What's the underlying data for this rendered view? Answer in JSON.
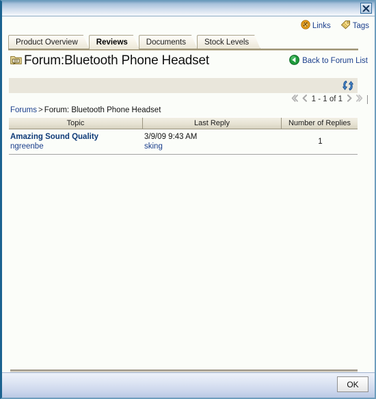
{
  "window": {
    "close_icon": "close-icon"
  },
  "toolbar": {
    "links_label": "Links",
    "links_icon": "links-chain-icon",
    "tags_label": "Tags",
    "tags_icon": "tag-icon"
  },
  "tabs": [
    {
      "label": "Product Overview",
      "active": false
    },
    {
      "label": "Reviews",
      "active": true
    },
    {
      "label": "Documents",
      "active": false
    },
    {
      "label": "Stock Levels",
      "active": false
    }
  ],
  "page": {
    "title": "Forum:Bluetooth Phone Headset",
    "title_icon": "forum-folder-icon",
    "back_label": "Back to Forum List",
    "back_icon": "back-arrow-icon"
  },
  "action_band": {
    "refresh_icon": "refresh-icon"
  },
  "pagination": {
    "first_icon": "first-page-icon",
    "prev_icon": "previous-page-icon",
    "range": "1 - 1 of 1",
    "next_icon": "next-page-icon",
    "last_icon": "last-page-icon"
  },
  "breadcrumb": {
    "root_label": "Forums",
    "separator": ">",
    "current_label": "Forum: Bluetooth Phone Headset"
  },
  "table": {
    "columns": [
      "Topic",
      "Last Reply",
      "Number of Replies"
    ],
    "rows": [
      {
        "topic": "Amazing Sound Quality",
        "topic_author": "ngreenbe",
        "last_reply_date": "3/9/09 9:43 AM",
        "last_reply_author": "sking",
        "replies": "1"
      }
    ]
  },
  "footer": {
    "ok_label": "OK"
  },
  "colors": {
    "link": "#1a3e8c",
    "topic_link": "#0e3a78",
    "band": "#e9e6db",
    "window_border": "#1b6390",
    "tab_border": "#a9a289"
  }
}
